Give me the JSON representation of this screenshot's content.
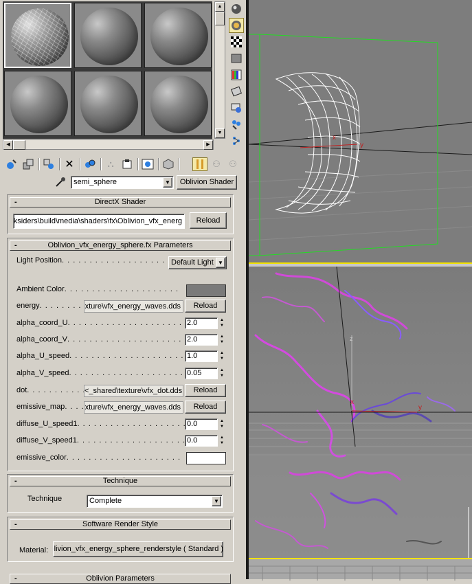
{
  "material_editor": {
    "slot_count": 6,
    "material_name": "semi_sphere",
    "shader_button": "Oblivion Shader"
  },
  "directx_shader": {
    "header": "DirectX Shader",
    "path": "arksiders\\build\\media\\shaders\\fx\\Oblivion_vfx_energ",
    "reload": "Reload"
  },
  "parameters": {
    "header": "Oblivion_vfx_energy_sphere.fx Parameters",
    "light_position": {
      "label": "Light Position",
      "value": "Default Light"
    },
    "ambient_color": {
      "label": "Ambient Color",
      "color": "#7a7a7a"
    },
    "energy": {
      "label": "energy",
      "map": "xture\\vfx_energy_waves.dds",
      "reload": "Reload"
    },
    "alpha_coord_U": {
      "label": "alpha_coord_U",
      "value": "2.0"
    },
    "alpha_coord_V": {
      "label": "alpha_coord_V",
      "value": "2.0"
    },
    "alpha_U_speed": {
      "label": "alpha_U_speed",
      "value": "1.0"
    },
    "alpha_V_speed": {
      "label": "alpha_V_speed",
      "value": "0.05"
    },
    "dot": {
      "label": "dot",
      "map": "<_shared\\texture\\vfx_dot.dds",
      "reload": "Reload"
    },
    "emissive_map": {
      "label": "emissive_map",
      "map": "xture\\vfx_energy_waves.dds",
      "reload": "Reload"
    },
    "diffuse_U_speed1": {
      "label": "diffuse_U_speed1",
      "value": "0.0"
    },
    "diffuse_V_speed1": {
      "label": "diffuse_V_speed1",
      "value": "0.0"
    },
    "emissive_color": {
      "label": "emissive_color",
      "color": "#ffffff"
    }
  },
  "technique": {
    "header": "Technique",
    "label": "Technique",
    "value": "Complete"
  },
  "software_render": {
    "header": "Software Render Style",
    "label": "Material:",
    "value": "Oblivion_vfx_energy_sphere_renderstyle  ( Standard )"
  },
  "oblivion_params": {
    "header": "Oblivion Parameters"
  },
  "viewport_top": {
    "axis_x": "x",
    "axis_y": "y",
    "bbox_color": "#22dd22"
  },
  "viewport_bottom": {
    "axis_x": "x",
    "axis_y": "y",
    "axis_z": "z"
  }
}
